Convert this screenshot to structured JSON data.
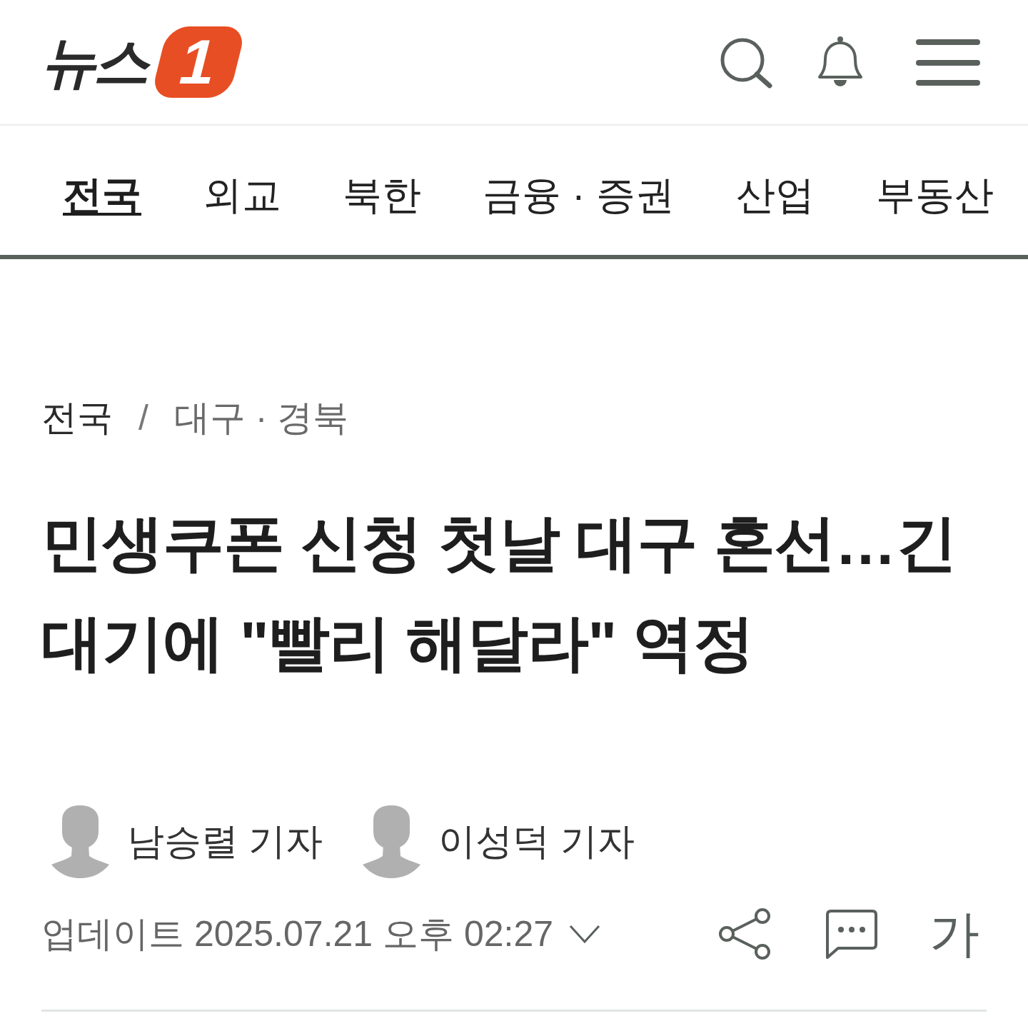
{
  "header": {
    "logo": {
      "wordmark": "뉴스",
      "badge": "1"
    }
  },
  "nav": {
    "tabs": [
      {
        "label": "전국",
        "selected": true
      },
      {
        "label": "외교",
        "selected": false
      },
      {
        "label": "북한",
        "selected": false
      },
      {
        "label": "금융 · 증권",
        "selected": false
      },
      {
        "label": "산업",
        "selected": false
      },
      {
        "label": "부동산",
        "selected": false
      }
    ]
  },
  "breadcrumb": {
    "items": [
      "전국",
      "대구 · 경북"
    ],
    "separator": "/"
  },
  "article": {
    "headline": "민생쿠폰 신청 첫날 대구 혼선…긴 대기에 \"빨리 해달라\" 역정",
    "reporters": [
      {
        "name": "남승렬 기자"
      },
      {
        "name": "이성덕 기자"
      }
    ],
    "updated": "업데이트 2025.07.21 오후 02:27",
    "font_size_button": "가"
  }
}
